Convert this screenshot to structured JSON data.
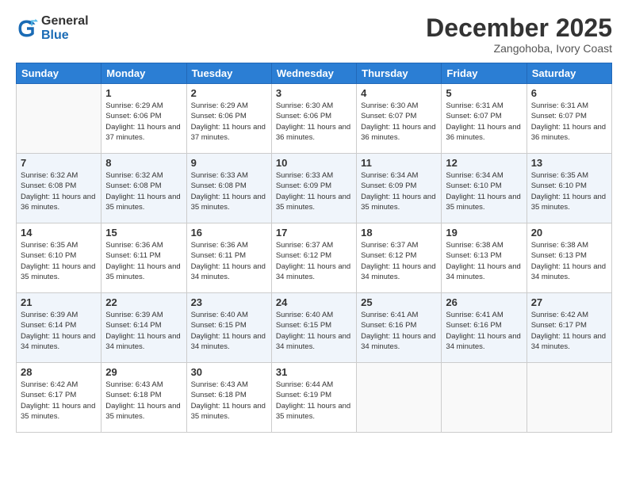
{
  "logo": {
    "general": "General",
    "blue": "Blue"
  },
  "title": "December 2025",
  "location": "Zangohoba, Ivory Coast",
  "days_header": [
    "Sunday",
    "Monday",
    "Tuesday",
    "Wednesday",
    "Thursday",
    "Friday",
    "Saturday"
  ],
  "weeks": [
    [
      {
        "day": "",
        "sunrise": "",
        "sunset": "",
        "daylight": ""
      },
      {
        "day": "1",
        "sunrise": "Sunrise: 6:29 AM",
        "sunset": "Sunset: 6:06 PM",
        "daylight": "Daylight: 11 hours and 37 minutes."
      },
      {
        "day": "2",
        "sunrise": "Sunrise: 6:29 AM",
        "sunset": "Sunset: 6:06 PM",
        "daylight": "Daylight: 11 hours and 37 minutes."
      },
      {
        "day": "3",
        "sunrise": "Sunrise: 6:30 AM",
        "sunset": "Sunset: 6:06 PM",
        "daylight": "Daylight: 11 hours and 36 minutes."
      },
      {
        "day": "4",
        "sunrise": "Sunrise: 6:30 AM",
        "sunset": "Sunset: 6:07 PM",
        "daylight": "Daylight: 11 hours and 36 minutes."
      },
      {
        "day": "5",
        "sunrise": "Sunrise: 6:31 AM",
        "sunset": "Sunset: 6:07 PM",
        "daylight": "Daylight: 11 hours and 36 minutes."
      },
      {
        "day": "6",
        "sunrise": "Sunrise: 6:31 AM",
        "sunset": "Sunset: 6:07 PM",
        "daylight": "Daylight: 11 hours and 36 minutes."
      }
    ],
    [
      {
        "day": "7",
        "sunrise": "Sunrise: 6:32 AM",
        "sunset": "Sunset: 6:08 PM",
        "daylight": "Daylight: 11 hours and 36 minutes."
      },
      {
        "day": "8",
        "sunrise": "Sunrise: 6:32 AM",
        "sunset": "Sunset: 6:08 PM",
        "daylight": "Daylight: 11 hours and 35 minutes."
      },
      {
        "day": "9",
        "sunrise": "Sunrise: 6:33 AM",
        "sunset": "Sunset: 6:08 PM",
        "daylight": "Daylight: 11 hours and 35 minutes."
      },
      {
        "day": "10",
        "sunrise": "Sunrise: 6:33 AM",
        "sunset": "Sunset: 6:09 PM",
        "daylight": "Daylight: 11 hours and 35 minutes."
      },
      {
        "day": "11",
        "sunrise": "Sunrise: 6:34 AM",
        "sunset": "Sunset: 6:09 PM",
        "daylight": "Daylight: 11 hours and 35 minutes."
      },
      {
        "day": "12",
        "sunrise": "Sunrise: 6:34 AM",
        "sunset": "Sunset: 6:10 PM",
        "daylight": "Daylight: 11 hours and 35 minutes."
      },
      {
        "day": "13",
        "sunrise": "Sunrise: 6:35 AM",
        "sunset": "Sunset: 6:10 PM",
        "daylight": "Daylight: 11 hours and 35 minutes."
      }
    ],
    [
      {
        "day": "14",
        "sunrise": "Sunrise: 6:35 AM",
        "sunset": "Sunset: 6:10 PM",
        "daylight": "Daylight: 11 hours and 35 minutes."
      },
      {
        "day": "15",
        "sunrise": "Sunrise: 6:36 AM",
        "sunset": "Sunset: 6:11 PM",
        "daylight": "Daylight: 11 hours and 35 minutes."
      },
      {
        "day": "16",
        "sunrise": "Sunrise: 6:36 AM",
        "sunset": "Sunset: 6:11 PM",
        "daylight": "Daylight: 11 hours and 34 minutes."
      },
      {
        "day": "17",
        "sunrise": "Sunrise: 6:37 AM",
        "sunset": "Sunset: 6:12 PM",
        "daylight": "Daylight: 11 hours and 34 minutes."
      },
      {
        "day": "18",
        "sunrise": "Sunrise: 6:37 AM",
        "sunset": "Sunset: 6:12 PM",
        "daylight": "Daylight: 11 hours and 34 minutes."
      },
      {
        "day": "19",
        "sunrise": "Sunrise: 6:38 AM",
        "sunset": "Sunset: 6:13 PM",
        "daylight": "Daylight: 11 hours and 34 minutes."
      },
      {
        "day": "20",
        "sunrise": "Sunrise: 6:38 AM",
        "sunset": "Sunset: 6:13 PM",
        "daylight": "Daylight: 11 hours and 34 minutes."
      }
    ],
    [
      {
        "day": "21",
        "sunrise": "Sunrise: 6:39 AM",
        "sunset": "Sunset: 6:14 PM",
        "daylight": "Daylight: 11 hours and 34 minutes."
      },
      {
        "day": "22",
        "sunrise": "Sunrise: 6:39 AM",
        "sunset": "Sunset: 6:14 PM",
        "daylight": "Daylight: 11 hours and 34 minutes."
      },
      {
        "day": "23",
        "sunrise": "Sunrise: 6:40 AM",
        "sunset": "Sunset: 6:15 PM",
        "daylight": "Daylight: 11 hours and 34 minutes."
      },
      {
        "day": "24",
        "sunrise": "Sunrise: 6:40 AM",
        "sunset": "Sunset: 6:15 PM",
        "daylight": "Daylight: 11 hours and 34 minutes."
      },
      {
        "day": "25",
        "sunrise": "Sunrise: 6:41 AM",
        "sunset": "Sunset: 6:16 PM",
        "daylight": "Daylight: 11 hours and 34 minutes."
      },
      {
        "day": "26",
        "sunrise": "Sunrise: 6:41 AM",
        "sunset": "Sunset: 6:16 PM",
        "daylight": "Daylight: 11 hours and 34 minutes."
      },
      {
        "day": "27",
        "sunrise": "Sunrise: 6:42 AM",
        "sunset": "Sunset: 6:17 PM",
        "daylight": "Daylight: 11 hours and 34 minutes."
      }
    ],
    [
      {
        "day": "28",
        "sunrise": "Sunrise: 6:42 AM",
        "sunset": "Sunset: 6:17 PM",
        "daylight": "Daylight: 11 hours and 35 minutes."
      },
      {
        "day": "29",
        "sunrise": "Sunrise: 6:43 AM",
        "sunset": "Sunset: 6:18 PM",
        "daylight": "Daylight: 11 hours and 35 minutes."
      },
      {
        "day": "30",
        "sunrise": "Sunrise: 6:43 AM",
        "sunset": "Sunset: 6:18 PM",
        "daylight": "Daylight: 11 hours and 35 minutes."
      },
      {
        "day": "31",
        "sunrise": "Sunrise: 6:44 AM",
        "sunset": "Sunset: 6:19 PM",
        "daylight": "Daylight: 11 hours and 35 minutes."
      },
      {
        "day": "",
        "sunrise": "",
        "sunset": "",
        "daylight": ""
      },
      {
        "day": "",
        "sunrise": "",
        "sunset": "",
        "daylight": ""
      },
      {
        "day": "",
        "sunrise": "",
        "sunset": "",
        "daylight": ""
      }
    ]
  ]
}
